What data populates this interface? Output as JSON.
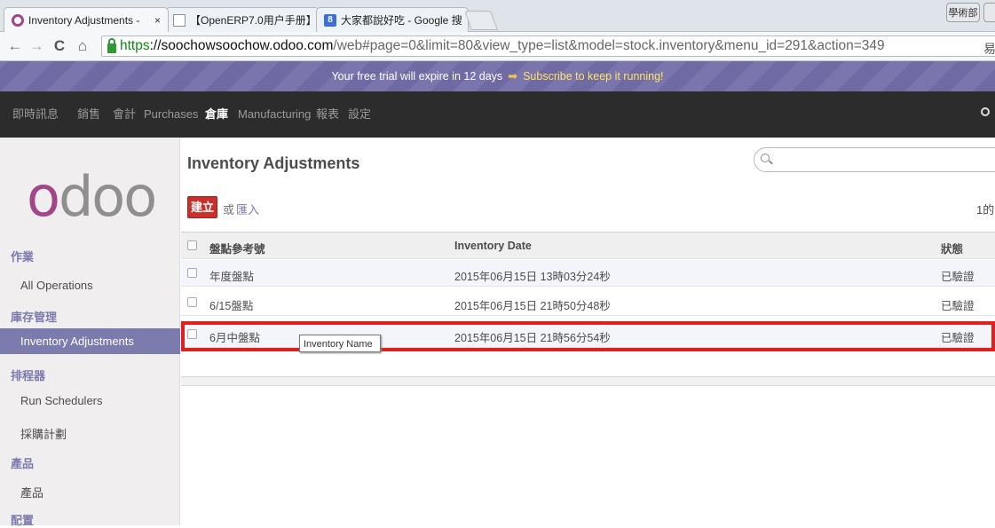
{
  "browser": {
    "tabs": [
      {
        "label": "Inventory Adjustments -",
        "icon": "odoo-icon",
        "close": "×"
      },
      {
        "label": "【OpenERP7.0用户手册】",
        "icon": "doc-icon",
        "close": "×"
      },
      {
        "label": "大家都說好吃 - Google 搜",
        "icon": "google-icon",
        "close": "×"
      }
    ],
    "user_button": "學術部",
    "url": {
      "scheme": "https",
      "rest_host": "://soochowsoochow.odoo.com",
      "path": "/web#page=0&limit=80&view_type=list&model=stock.inventory&menu_id=291&action=349"
    },
    "right_edge_glyph": "易"
  },
  "banner": {
    "text": "Your free trial will expire in 12 days",
    "link": "Subscribe to keep it running!"
  },
  "topmenu": {
    "items": [
      "即時訊息",
      "銷售",
      "會計",
      "Purchases",
      "倉庫",
      "Manufacturing",
      "報表",
      "設定"
    ],
    "active": "倉庫"
  },
  "sidebar": {
    "logo": {
      "o": "o",
      "d": "d",
      "oo": "oo"
    },
    "sections": [
      {
        "title": "作業",
        "items": [
          "All Operations"
        ]
      },
      {
        "title": "庫存管理",
        "items": [
          "Inventory Adjustments"
        ]
      },
      {
        "title": "排程器",
        "items": [
          "Run Schedulers",
          "採購計劃"
        ]
      },
      {
        "title": "產品",
        "items": [
          "產品"
        ]
      },
      {
        "title": "配置",
        "items": []
      }
    ]
  },
  "main": {
    "title": "Inventory Adjustments",
    "create_label": "建立",
    "or_label": "或",
    "import_label": "匯入",
    "pager": "1的",
    "columns": [
      "盤點參考號",
      "Inventory Date",
      "狀態"
    ],
    "rows": [
      {
        "name": "年度盤點",
        "date": "2015年06月15日 13時03分24秒",
        "status": "已驗證"
      },
      {
        "name": "6/15盤點",
        "date": "2015年06月15日 21時50分48秒",
        "status": "已驗證"
      },
      {
        "name": "6月中盤點",
        "date": "2015年06月15日 21時56分54秒",
        "status": "已驗證"
      }
    ],
    "tooltip": "Inventory Name"
  },
  "colors": {
    "brand": "#a24689",
    "accent": "#7c7bad",
    "create_button": "#c9302c",
    "highlight": "#e0201f"
  }
}
